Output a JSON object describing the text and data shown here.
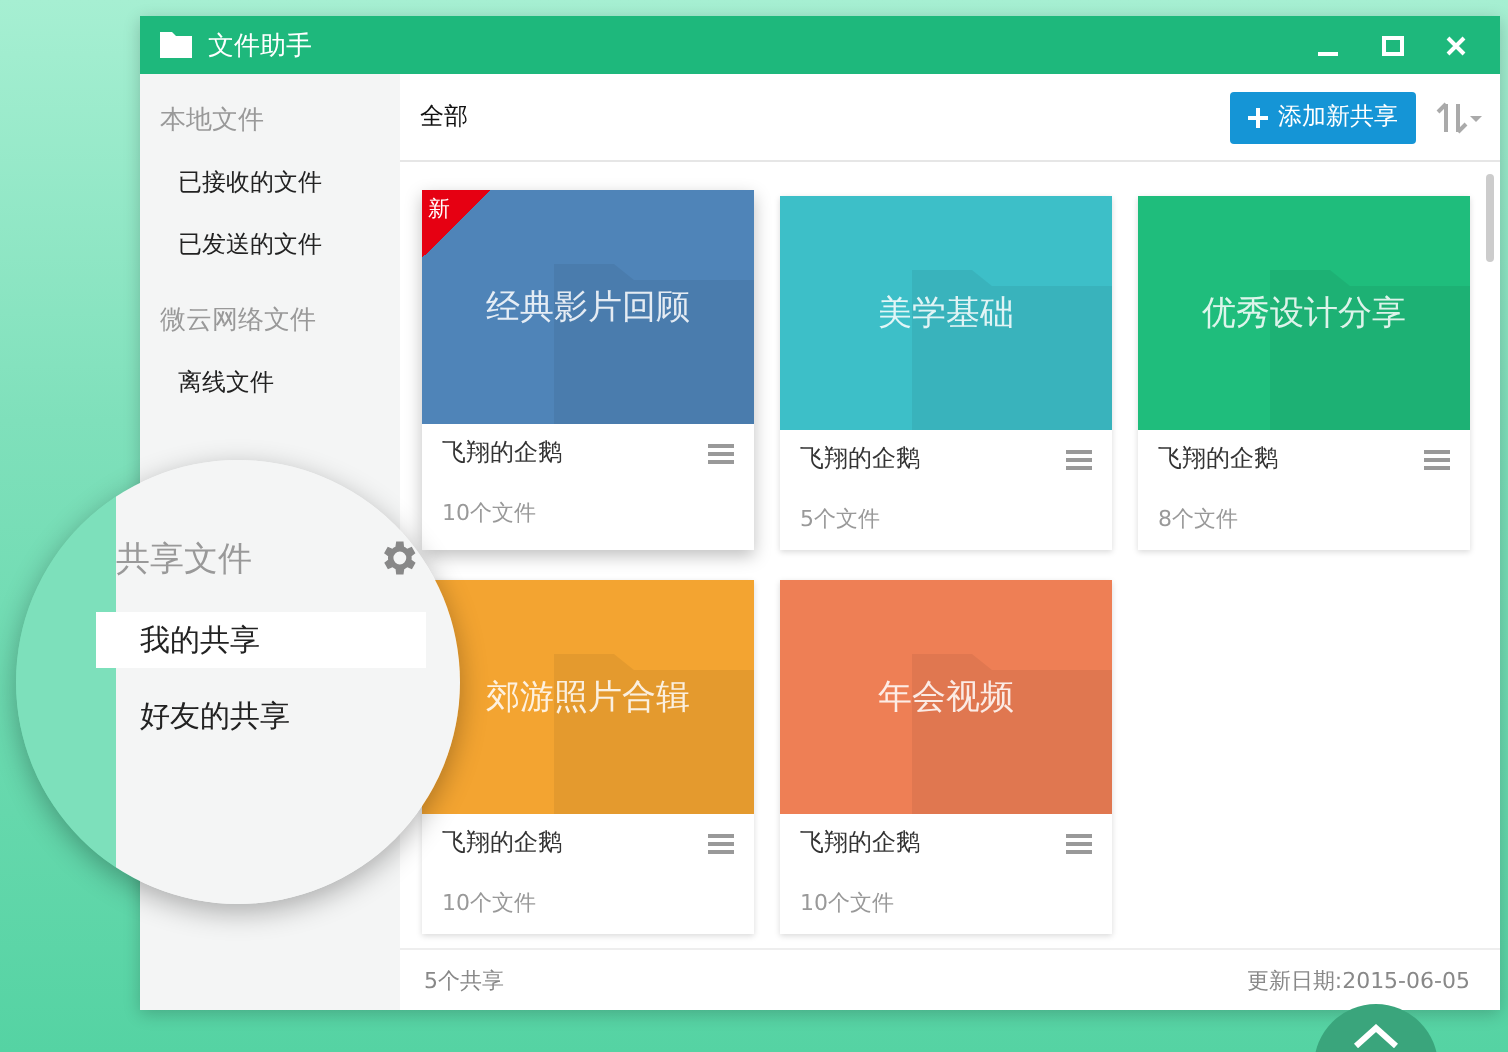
{
  "window": {
    "title": "文件助手"
  },
  "sidebar": {
    "sections": [
      {
        "title": "本地文件",
        "items": [
          {
            "label": "已接收的文件"
          },
          {
            "label": "已发送的文件"
          }
        ]
      },
      {
        "title": "微云网络文件",
        "items": [
          {
            "label": "离线文件"
          }
        ]
      }
    ]
  },
  "magnifier": {
    "title": "共享文件",
    "items": [
      {
        "label": "我的共享",
        "selected": true
      },
      {
        "label": "好友的共享",
        "selected": false
      }
    ]
  },
  "toolbar": {
    "filter": "全部",
    "add_button": "添加新共享"
  },
  "shares": [
    {
      "title": "经典影片回顾",
      "owner": "飞翔的企鹅",
      "count": "10个文件",
      "color": "#4f84b8",
      "badge": "新",
      "selected": true
    },
    {
      "title": "美学基础",
      "owner": "飞翔的企鹅",
      "count": "5个文件",
      "color": "#3dbfc8",
      "selected": false
    },
    {
      "title": "优秀设计分享",
      "owner": "飞翔的企鹅",
      "count": "8个文件",
      "color": "#1fbd7c",
      "selected": false
    },
    {
      "title": "郊游照片合辑",
      "owner": "飞翔的企鹅",
      "count": "10个文件",
      "color": "#f3a431",
      "selected": false
    },
    {
      "title": "年会视频",
      "owner": "飞翔的企鹅",
      "count": "10个文件",
      "color": "#ee7f55",
      "selected": false
    }
  ],
  "status_bar": {
    "total": "5个共享",
    "updated": "更新日期:2015-06-05"
  }
}
